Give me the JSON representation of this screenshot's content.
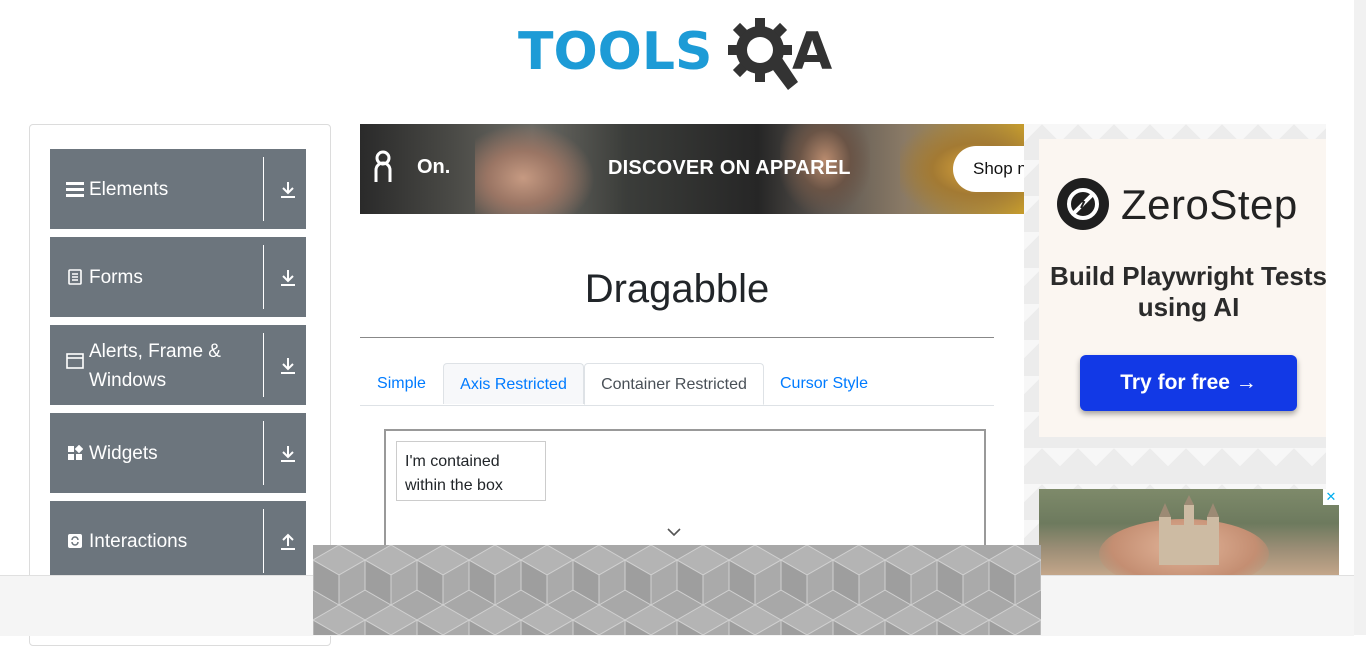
{
  "logo": {
    "text_tools": "TOOLS",
    "text_a": "A"
  },
  "sidebar": {
    "groups": [
      {
        "label": "Elements",
        "icon": "hamburger-icon",
        "arrow": "download-arrow-icon"
      },
      {
        "label": "Forms",
        "icon": "document-icon",
        "arrow": "download-arrow-icon"
      },
      {
        "label": "Alerts, Frame & Windows",
        "icon": "window-icon",
        "arrow": "download-arrow-icon"
      },
      {
        "label": "Widgets",
        "icon": "widgets-grid-icon",
        "arrow": "download-arrow-icon"
      },
      {
        "label": "Interactions",
        "icon": "refresh-icon",
        "arrow": "upload-arrow-icon"
      }
    ]
  },
  "top_ad": {
    "logo": "On.",
    "headline": "DISCOVER ON APPAREL",
    "cta": "Shop n"
  },
  "main": {
    "title": "Dragabble",
    "tabs": [
      {
        "label": "Simple",
        "state": "link"
      },
      {
        "label": "Axis Restricted",
        "state": "hover"
      },
      {
        "label": "Container Restricted",
        "state": "active"
      },
      {
        "label": "Cursor Style",
        "state": "link"
      }
    ],
    "drag_box_text": "I'm contained within the box"
  },
  "right_ad": {
    "brand": "ZeroStep",
    "tagline": "Build Playwright Tests using AI",
    "cta": "Try for free →"
  },
  "castle_ad": {
    "close": "✕"
  },
  "colors": {
    "sidebar_group_bg": "#6c757d",
    "link_blue": "#007bff",
    "logo_blue": "#1d9bd6",
    "zerostep_button": "#1239e6"
  }
}
